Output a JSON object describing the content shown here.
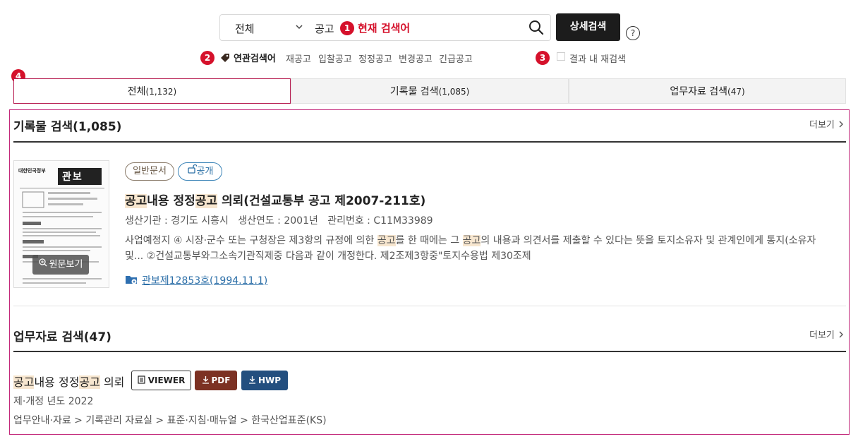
{
  "search": {
    "scope": "전체",
    "query": "공고",
    "current_label": "현재 검색어",
    "advanced_label": "상세검색",
    "help": "?"
  },
  "badges": [
    "1",
    "2",
    "3",
    "4"
  ],
  "related": {
    "label": "연관검색어",
    "keywords": [
      "재공고",
      "입찰공고",
      "정정공고",
      "변경공고",
      "긴급공고"
    ],
    "re_search_label": "결과 내 재검색"
  },
  "tabs": [
    {
      "label": "전체",
      "count": "(1,132)",
      "active": true
    },
    {
      "label": "기록물 검색",
      "count": "(1,085)",
      "active": false
    },
    {
      "label": "업무자료 검색",
      "count": "(47)",
      "active": false
    }
  ],
  "records": {
    "title": "기록물 검색(1,085)",
    "more": "더보기",
    "item": {
      "pill_general": "일반문서",
      "pill_open": "공개",
      "title_parts": [
        {
          "text": "공고",
          "hl": true
        },
        {
          "text": "내용 정정",
          "hl": false
        },
        {
          "text": "공고",
          "hl": true
        },
        {
          "text": " 의뢰(건설교통부 공고 제2007-211호)",
          "hl": false
        }
      ],
      "meta": "생산기관 : 경기도 시흥시   생산연도 : 2001년   관리번호 : C11M33989",
      "snippet_parts": [
        {
          "text": "사업예정지 ④ 시장·군수 또는 구청장은 제3항의 규정에 의한 ",
          "hl": false
        },
        {
          "text": "공고",
          "hl": true
        },
        {
          "text": "를 한 때에는 그 ",
          "hl": false
        },
        {
          "text": "공고",
          "hl": true
        },
        {
          "text": "의 내용과 의견서를 제출할 수 있다는 뜻을 토지소유자 및 관계인에게 통지(소유자 및... ②건설교통부와그소속기관직제중 다음과 같이 개정한다. 제2조제3항중\"토지수용법 제30조제",
          "hl": false
        }
      ],
      "link": "관보제12853호(1994.11.1)",
      "view_original": "원문보기",
      "thumb_header": "관보",
      "thumb_org": "대한민국정부"
    }
  },
  "work": {
    "title": "업무자료 검색(47)",
    "more": "더보기",
    "item": {
      "title_parts": [
        {
          "text": "공고",
          "hl": true
        },
        {
          "text": "내용 정정",
          "hl": false
        },
        {
          "text": "공고",
          "hl": true
        },
        {
          "text": " 의뢰",
          "hl": false
        }
      ],
      "viewer": "VIEWER",
      "pdf": "PDF",
      "hwp": "HWP",
      "year": "제·개정 년도 2022",
      "path": "업무안내·자료 > 기록관리 자료실 > 표준·지침·매뉴얼 > 한국산업표준(KS)"
    }
  },
  "colors": {
    "badge": "#d5112b",
    "active_tab_border": "#b81f53",
    "frame_border": "#c3287a",
    "highlight": "#f7e6cf",
    "pdf": "#7c3123",
    "hwp": "#234f7f"
  }
}
